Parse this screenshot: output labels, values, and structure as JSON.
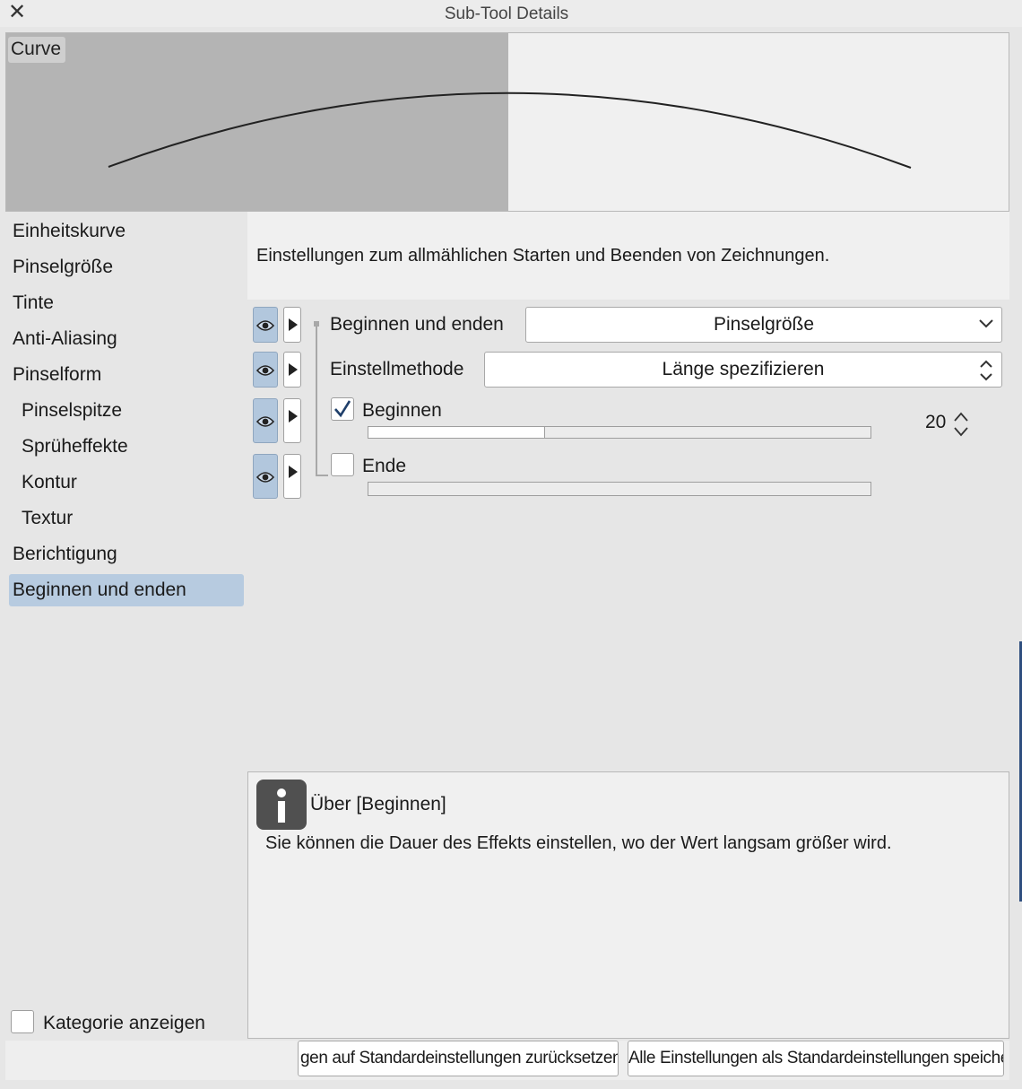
{
  "window": {
    "title": "Sub-Tool Details",
    "close_glyph": "✕"
  },
  "curve_preview": {
    "label": "Curve"
  },
  "sidebar": {
    "items": [
      {
        "label": "Einheitskurve",
        "indent": false,
        "selected": false
      },
      {
        "label": "Pinselgröße",
        "indent": false,
        "selected": false
      },
      {
        "label": "Tinte",
        "indent": false,
        "selected": false
      },
      {
        "label": "Anti-Aliasing",
        "indent": false,
        "selected": false
      },
      {
        "label": "Pinselform",
        "indent": false,
        "selected": false
      },
      {
        "label": "Pinselspitze",
        "indent": true,
        "selected": false
      },
      {
        "label": "Sprüheffekte",
        "indent": true,
        "selected": false
      },
      {
        "label": "Kontur",
        "indent": true,
        "selected": false
      },
      {
        "label": "Textur",
        "indent": true,
        "selected": false
      },
      {
        "label": "Berichtigung",
        "indent": false,
        "selected": false
      },
      {
        "label": "Beginnen und enden",
        "indent": false,
        "selected": true
      }
    ],
    "show_category": {
      "label": "Kategorie anzeigen",
      "checked": false
    }
  },
  "description": "Einstellungen zum allmählichen Starten und Beenden von Zeichnungen.",
  "settings": {
    "start_end": {
      "label": "Beginnen und enden",
      "value": "Pinselgröße"
    },
    "method": {
      "label": "Einstellmethode",
      "value": "Länge spezifizieren"
    },
    "begin": {
      "label": "Beginnen",
      "checked": true,
      "value": "20",
      "fill_fraction": 0.35
    },
    "end": {
      "label": "Ende",
      "checked": false,
      "fill_fraction": 0
    }
  },
  "info": {
    "title": "Über [Beginnen]",
    "text": "Sie können die Dauer des Effekts einstellen, wo der Wert langsam größer wird."
  },
  "footer": {
    "reset_label": "gen auf Standardeinstellungen zurücksetzen",
    "save_label": "Alle Einstellungen als Standardeinstellungen speichern"
  },
  "colors": {
    "selection": "#b7cbe0",
    "visibility_toggle": "#b2c7dd",
    "info_icon": "#505050"
  },
  "icons": [
    "close-icon",
    "eye-icon",
    "expand-arrow-icon",
    "chevron-down-icon",
    "updown-icon",
    "checkmark-icon",
    "info-icon"
  ]
}
